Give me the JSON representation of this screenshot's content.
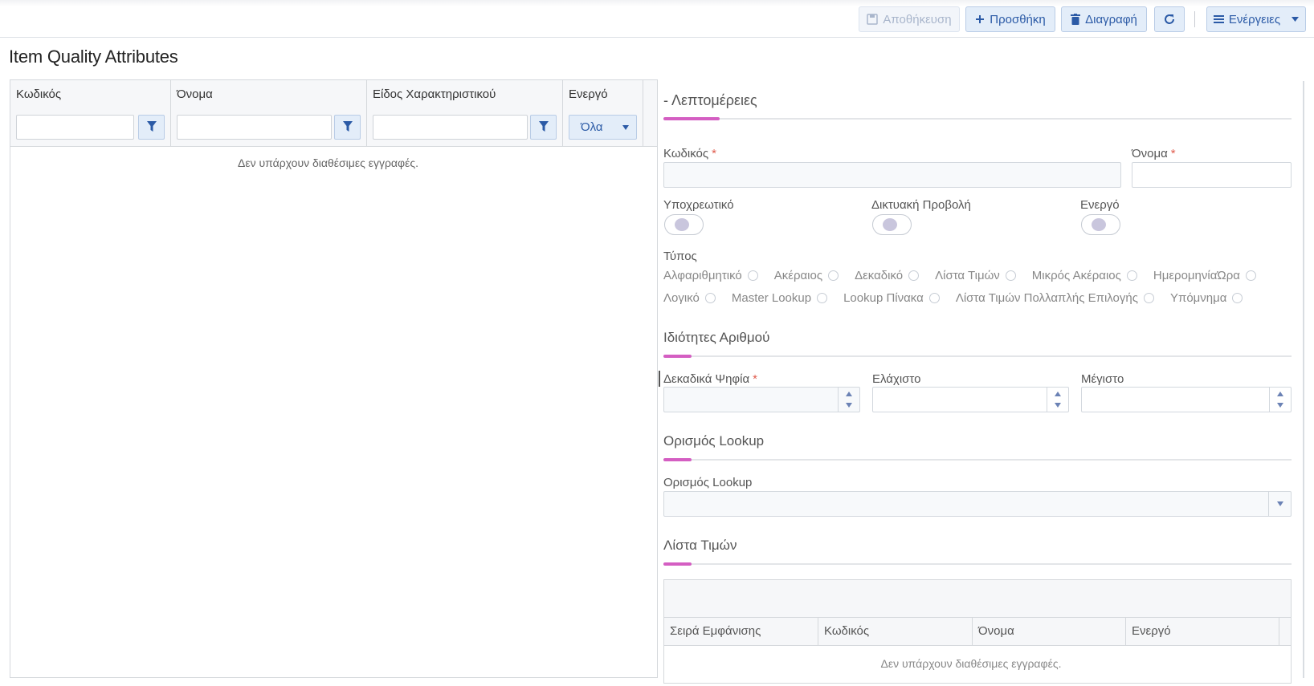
{
  "toolbar": {
    "save_label": "Αποθήκευση",
    "add_label": "Προσθήκη",
    "delete_label": "Διαγραφή",
    "actions_label": "Ενέργειες"
  },
  "page": {
    "title": "Item Quality Attributes"
  },
  "grid": {
    "columns": [
      "Κωδικός",
      "Όνομα",
      "Είδος Χαρακτηριστικού",
      "Ενεργό"
    ],
    "active_filter_value": "Όλα",
    "empty_message": "Δεν υπάρχουν διαθέσιμες εγγραφές."
  },
  "details": {
    "title": "- Λεπτομέρειες",
    "code_label": "Κωδικός",
    "name_label": "Όνομα",
    "required_label": "Υποχρεωτικό",
    "web_view_label": "Δικτυακή Προβολή",
    "active_label": "Ενεργό",
    "type_label": "Τύπος",
    "type_options_row1": [
      "Αλφαριθμητικό",
      "Ακέραιος",
      "Δεκαδικό",
      "Λίστα Τιμών",
      "Μικρός Ακέραιος",
      "ΗμερομηνίαΏρα"
    ],
    "type_options_row2": [
      "Λογικό",
      "Master Lookup",
      "Lookup Πίνακα",
      "Λίστα Τιμών Πολλαπλής Επιλογής",
      "Υπόμνημα"
    ]
  },
  "number_section": {
    "title": "Ιδιότητες Αριθμού",
    "decimals_label": "Δεκαδικά Ψηφία",
    "min_label": "Ελάχιστο",
    "max_label": "Μέγιστο"
  },
  "lookup_section": {
    "title": "Ορισμός Lookup",
    "field_label": "Ορισμός Lookup"
  },
  "values_section": {
    "title": "Λίστα Τιμών",
    "columns": [
      "Σειρά Εμφάνισης",
      "Κωδικός",
      "Όνομα",
      "Ενεργό"
    ],
    "empty_message": "Δεν υπάρχουν διαθέσιμες εγγραφές."
  },
  "colors": {
    "accent": "#d45ec2",
    "button_bg": "#e3edf9",
    "button_text": "#2b5aa6",
    "required": "#e05c4e"
  }
}
